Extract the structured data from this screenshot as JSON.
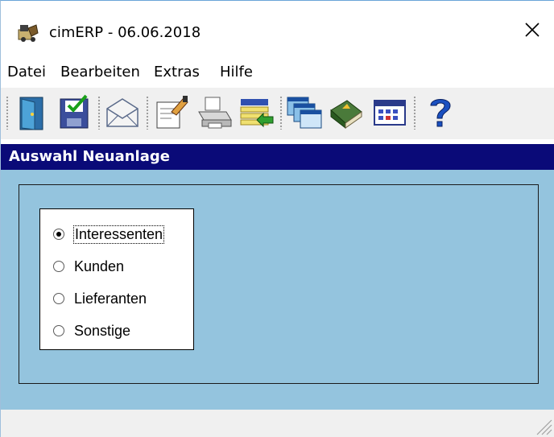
{
  "window": {
    "title": "cimERP - 06.06.2018",
    "close_glyph": "✕"
  },
  "menu": {
    "items": [
      {
        "label": "Datei"
      },
      {
        "label": "Bearbeiten"
      },
      {
        "label": "Extras"
      },
      {
        "label": "Hilfe"
      }
    ]
  },
  "toolbar": {
    "buttons": [
      {
        "icon": "exit-door-icon"
      },
      {
        "icon": "save-icon"
      },
      {
        "icon": "mail-icon"
      },
      {
        "icon": "edit-document-icon"
      },
      {
        "icon": "print-icon"
      },
      {
        "icon": "list-import-icon"
      },
      {
        "icon": "windows-icon"
      },
      {
        "icon": "book-icon"
      },
      {
        "icon": "calendar-icon"
      },
      {
        "icon": "help-icon"
      }
    ]
  },
  "section": {
    "header": "Auswahl Neuanlage"
  },
  "options": {
    "selected": "Interessenten",
    "items": [
      {
        "label": "Interessenten"
      },
      {
        "label": "Kunden"
      },
      {
        "label": "Lieferanten"
      },
      {
        "label": "Sonstige"
      }
    ]
  },
  "colors": {
    "header_bg": "#0a0a78",
    "content_bg": "#94c4de"
  }
}
